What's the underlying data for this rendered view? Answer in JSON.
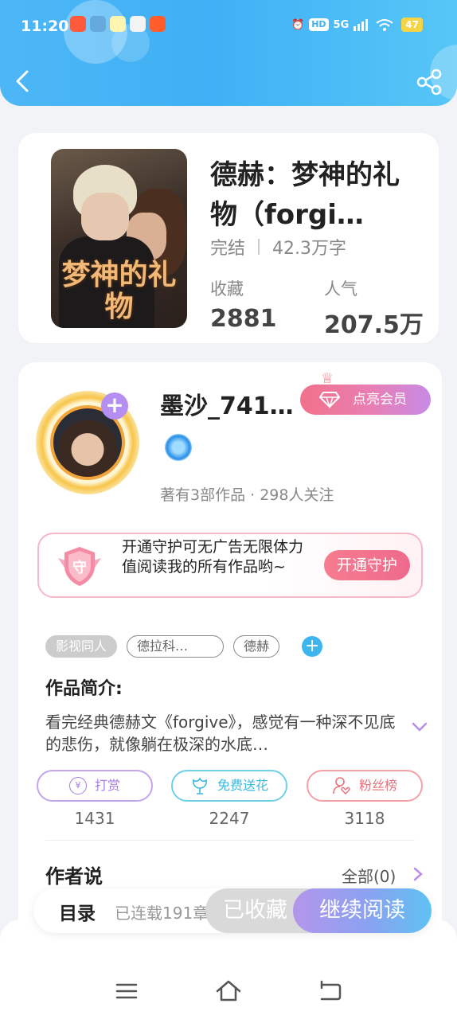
{
  "status_bar": {
    "time": "11:20",
    "hd": "HD",
    "network": "5G",
    "battery": "47"
  },
  "book": {
    "title": "德赫：梦神的礼物（forgi…",
    "cover_title": "梦神的礼物",
    "status": "完结",
    "word_count": "42.3万字",
    "favorites_label": "收藏",
    "favorites_value": "2881",
    "popularity_label": "人气",
    "popularity_value": "207.5万"
  },
  "author": {
    "name": "墨沙_741…",
    "vip_label": "点亮会员",
    "meta": "著有3部作品 · 298人关注"
  },
  "guard": {
    "text": "开通守护可无广告无限体力值阅读我的所有作品哟~",
    "shield_char": "守",
    "button": "开通守护"
  },
  "tags": [
    "影视同人",
    "德拉科…",
    "德赫"
  ],
  "intro": {
    "label": "作品简介:",
    "text": "看完经典德赫文《forgive》，感觉有一种深不见底的悲伤，就像躺在极深的水底…"
  },
  "actions": [
    {
      "label": "打赏",
      "icon": "¥",
      "count": "1431"
    },
    {
      "label": "免费送花",
      "icon": "flower-icon",
      "count": "2247"
    },
    {
      "label": "粉丝榜",
      "icon": "fans-icon",
      "count": "3118"
    }
  ],
  "author_says": {
    "title": "作者说",
    "all_link": "全部(0)"
  },
  "bottom_bar": {
    "toc": "目录",
    "serial": "已连载191章",
    "collected": "已收藏",
    "continue": "继续阅读"
  },
  "colors": {
    "header": "#4db7f6",
    "accent_pink": "#ee6a8d",
    "accent_purple": "#b396ec",
    "accent_blue": "#3fb5ee"
  }
}
